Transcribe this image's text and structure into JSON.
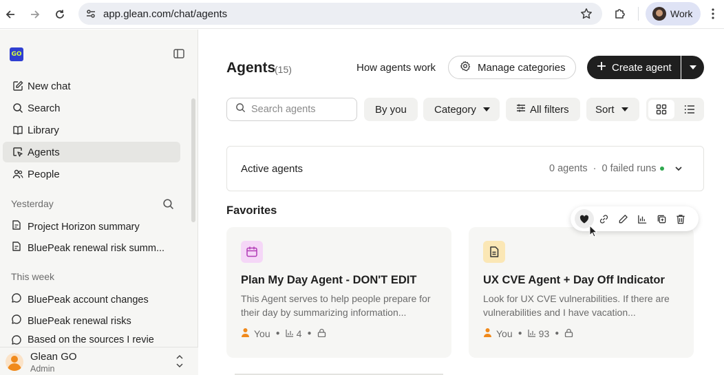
{
  "browser": {
    "url": "app.glean.com/chat/agents",
    "profile_label": "Work"
  },
  "sidebar": {
    "logo_text": "GO",
    "nav": [
      {
        "label": "New chat",
        "icon": "edit-icon"
      },
      {
        "label": "Search",
        "icon": "search-icon"
      },
      {
        "label": "Library",
        "icon": "book-icon"
      },
      {
        "label": "Agents",
        "icon": "agent-icon",
        "active": true
      },
      {
        "label": "People",
        "icon": "people-icon"
      }
    ],
    "sections": [
      {
        "label": "Yesterday",
        "items": [
          "Project Horizon summary",
          "BluePeak renewal risk summ..."
        ]
      },
      {
        "label": "This week",
        "items": [
          "BluePeak account changes",
          "BluePeak renewal risks",
          "Based on the sources I revie"
        ]
      }
    ],
    "user": {
      "name": "Glean GO",
      "role": "Admin"
    }
  },
  "header": {
    "title": "Agents",
    "count": "(15)",
    "how_link": "How agents work",
    "manage_label": "Manage categories",
    "create_label": "Create agent"
  },
  "filters": {
    "search_placeholder": "Search agents",
    "by_you": "By you",
    "category": "Category",
    "all_filters": "All filters",
    "sort": "Sort"
  },
  "active_agents": {
    "label": "Active agents",
    "agents": "0 agents",
    "separator": "·",
    "failed": "0 failed runs",
    "status_color": "#2fa84f"
  },
  "favorites": {
    "title": "Favorites",
    "cards": [
      {
        "name": "Plan My Day Agent - DON'T EDIT",
        "description": "This Agent serves to help people prepare for their day by summarizing information...",
        "owner": "You",
        "runs": "4",
        "icon": "calendar-icon",
        "icon_bg": "#f5d7f7"
      },
      {
        "name": "UX CVE Agent + Day Off Indicator",
        "description": "Look for UX CVE vulnerabilities. If there are vulnerabilities and I have vacation...",
        "owner": "You",
        "runs": "93",
        "icon": "document-icon",
        "icon_bg": "#fbe7b5"
      }
    ]
  },
  "hover_actions": [
    "heart-icon",
    "link-icon",
    "pencil-icon",
    "chart-icon",
    "copy-icon",
    "trash-icon"
  ]
}
